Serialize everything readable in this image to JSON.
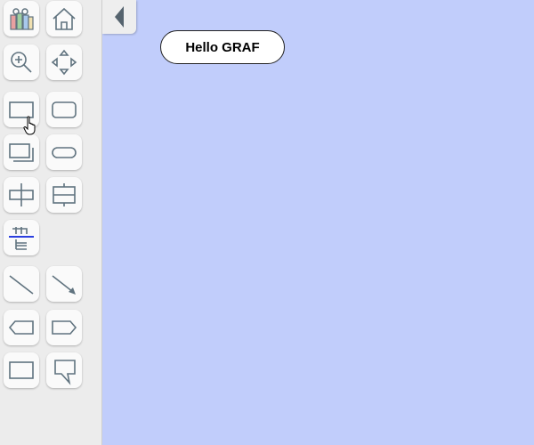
{
  "toolbar": {
    "tools": [
      {
        "name": "theme-palette-icon"
      },
      {
        "name": "home-icon"
      },
      {
        "name": "zoom-in-icon"
      },
      {
        "name": "pan-move-icon"
      },
      {
        "name": "rectangle-icon"
      },
      {
        "name": "rounded-rectangle-icon"
      },
      {
        "name": "stacked-rectangles-icon"
      },
      {
        "name": "pill-shape-icon"
      },
      {
        "name": "horizontal-split-node-icon"
      },
      {
        "name": "vertical-split-node-icon"
      },
      {
        "name": "tree-layout-icon"
      },
      {
        "name": "line-icon"
      },
      {
        "name": "arrow-icon"
      },
      {
        "name": "hexagon-tag-icon"
      },
      {
        "name": "pentagon-tag-icon"
      },
      {
        "name": "box-icon"
      },
      {
        "name": "speech-callout-icon"
      }
    ]
  },
  "collapse": {
    "icon": "triangle-left-icon"
  },
  "canvas": {
    "background": "#c1cdfb",
    "node": {
      "label": "Hello GRAF"
    }
  }
}
